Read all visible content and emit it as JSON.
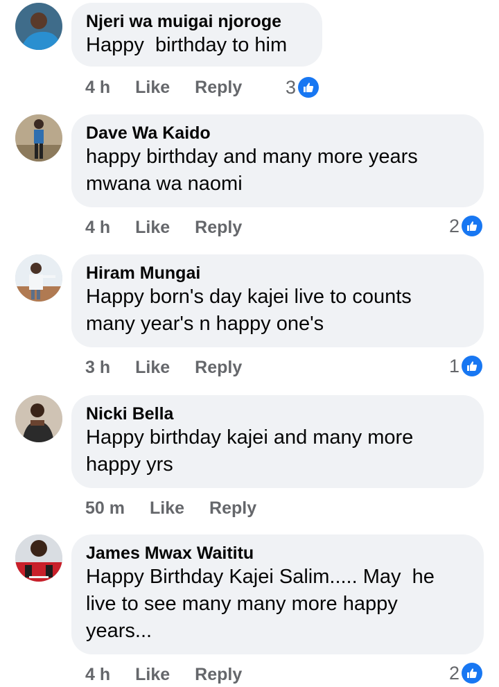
{
  "comments": [
    {
      "author": "Njeri wa muigai njoroge",
      "text": "Happy  birthday to him",
      "time": "4 h",
      "like_label": "Like",
      "reply_label": "Reply",
      "reaction_count": "3"
    },
    {
      "author": "Dave Wa Kaido",
      "text": "happy birthday and many more years\nmwana wa naomi",
      "time": "4 h",
      "like_label": "Like",
      "reply_label": "Reply",
      "reaction_count": "2"
    },
    {
      "author": "Hiram Mungai",
      "text": "Happy born's day kajei live to counts\nmany year's n happy one's",
      "time": "3 h",
      "like_label": "Like",
      "reply_label": "Reply",
      "reaction_count": "1"
    },
    {
      "author": "Nicki Bella",
      "text": "Happy birthday kajei and many more\nhappy yrs",
      "time": "50 m",
      "like_label": "Like",
      "reply_label": "Reply",
      "reaction_count": ""
    },
    {
      "author": "James Mwax Waititu",
      "text": "Happy Birthday Kajei Salim..... May  he\nlive to see many many more happy\nyears...",
      "time": "4 h",
      "like_label": "Like",
      "reply_label": "Reply",
      "reaction_count": "2"
    }
  ],
  "colors": {
    "bubble": "#f0f2f5",
    "meta": "#65676b",
    "like_badge": "#1877f2"
  },
  "icons": {
    "reaction": "thumbs-up-icon"
  }
}
